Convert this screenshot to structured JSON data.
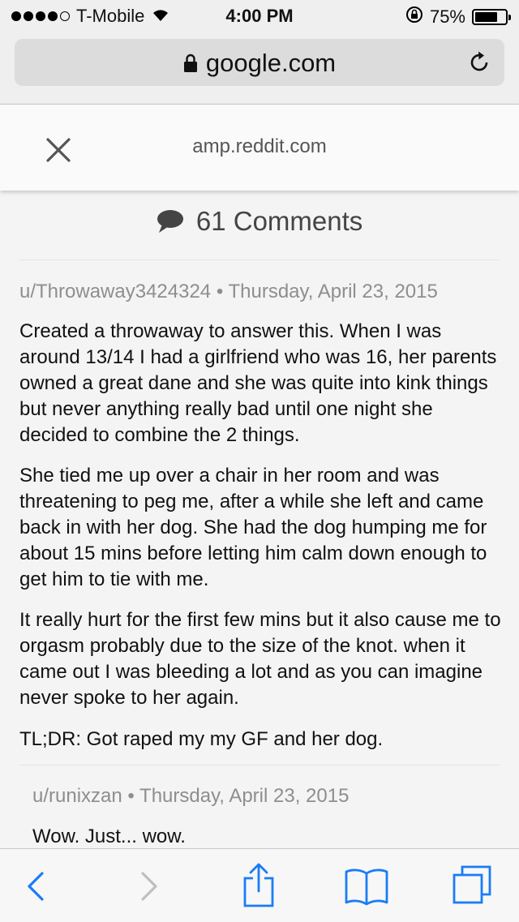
{
  "status_bar": {
    "carrier": "T-Mobile",
    "time": "4:00 PM",
    "battery_percent": "75%",
    "battery_level": 0.75,
    "signal_bars_filled": 4,
    "icons": [
      "wifi-icon",
      "orientation-lock-icon",
      "battery-icon"
    ]
  },
  "browser": {
    "url": "google.com",
    "lock_icon": "lock-icon",
    "reload_icon": "reload-icon"
  },
  "amp_header": {
    "host": "amp.reddit.com",
    "close_icon": "close-icon"
  },
  "comments_header": {
    "label": "61 Comments",
    "icon": "speech-bubble-icon"
  },
  "post": {
    "author": "u/Throwaway3424324",
    "separator": "•",
    "date": "Thursday, April 23, 2015",
    "paragraphs": [
      "Created a throwaway to answer this. When I was around 13/14 I had a girlfriend who was 16, her parents owned a great dane and she was quite into kink things but never anything really bad until one night she decided to combine the 2 things.",
      "She tied me up over a chair in her room and was threatening to peg me, after a while she left and came back in with her dog. She had the dog humping me for about 15 mins before letting him calm down enough to get him to tie with me.",
      "It really hurt for the first few mins but it also cause me to orgasm probably due to the size of the knot. when it came out I was bleeding a lot and as you can imagine never spoke to her again.",
      "TL;DR: Got raped my my GF and her dog."
    ]
  },
  "reply": {
    "author": "u/runixzan",
    "separator": "•",
    "date": "Thursday, April 23, 2015",
    "text": "Wow. Just... wow."
  },
  "toolbar": {
    "icons": [
      "back-icon",
      "forward-icon",
      "share-icon",
      "bookmarks-icon",
      "tabs-icon"
    ],
    "accent_color": "#1a7cf5",
    "disabled_color": "#bfbfbf"
  }
}
